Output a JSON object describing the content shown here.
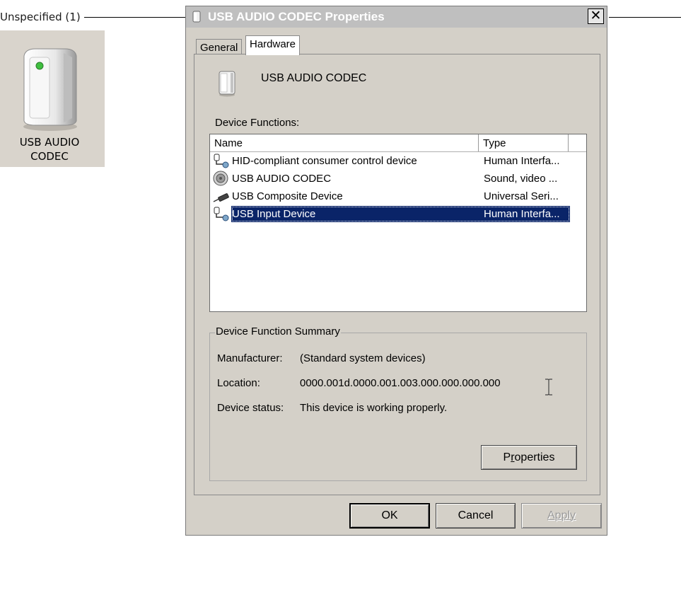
{
  "desktop": {
    "group_header": "Unspecified (1)",
    "device_icon": "computer-tower-icon",
    "device_label_line1": "USB AUDIO",
    "device_label_line2": "CODEC"
  },
  "dialog": {
    "title": "USB AUDIO  CODEC Properties",
    "close_label": "✕",
    "tabs": [
      {
        "label": "General",
        "active": false
      },
      {
        "label": "Hardware",
        "active": true
      }
    ],
    "device_name": "USB AUDIO  CODEC",
    "functions_label": "Device Functions:",
    "columns": {
      "name": "Name",
      "type": "Type"
    },
    "functions": [
      {
        "name": "HID-compliant consumer control device",
        "type": "Human Interfa...",
        "icon": "hid-device-icon"
      },
      {
        "name": "USB AUDIO  CODEC",
        "type": "Sound, video ...",
        "icon": "speaker-icon"
      },
      {
        "name": "USB Composite Device",
        "type": "Universal Seri...",
        "icon": "usb-plug-icon"
      },
      {
        "name": "USB Input Device",
        "type": "Human Interfa...",
        "icon": "hid-device-icon",
        "selected": true
      }
    ],
    "summary": {
      "title": "Device Function Summary",
      "manufacturer_label": "Manufacturer:",
      "manufacturer_value": "(Standard system devices)",
      "location_label": "Location:",
      "location_value": "0000.001d.0000.001.003.000.000.000.000",
      "status_label": "Device status:",
      "status_value": "This device is working properly.",
      "properties_button": "Properties",
      "properties_mnemonic": "r"
    },
    "buttons": {
      "ok": "OK",
      "cancel": "Cancel",
      "apply": "Apply"
    }
  },
  "colors": {
    "selection": "#0a2468",
    "dialog_bg": "#d4d0c8",
    "titlebar": "#bfbfbf"
  }
}
